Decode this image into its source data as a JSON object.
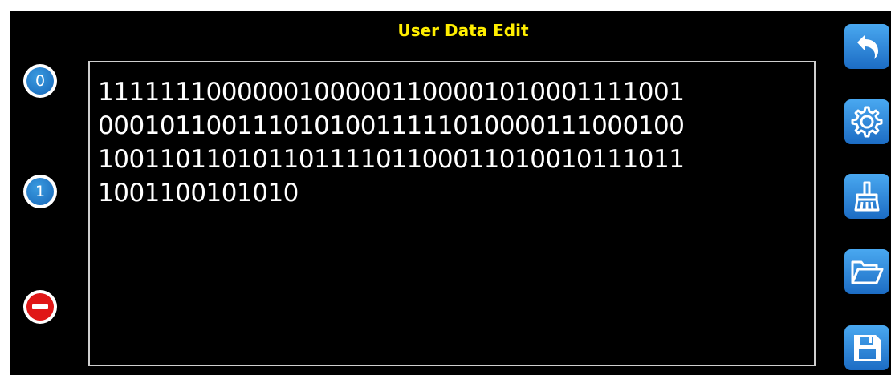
{
  "title": "User Data Edit",
  "keypad": {
    "zero_label": "0",
    "one_label": "1"
  },
  "editor": {
    "lines": [
      "11111110000001000001100001010001111001",
      "00010110011101010011111010000111000100",
      "10011011010110111101100011010010111011",
      "1001100101010"
    ]
  },
  "toolbar": {
    "icons": [
      "back-icon",
      "gear-icon",
      "broom-icon",
      "folder-open-icon",
      "floppy-disk-icon"
    ]
  },
  "colors": {
    "title": "#ffee00",
    "key_blue": "#1f78d1",
    "key_red": "#e01717",
    "tool_gradient_top": "#49a8f0",
    "tool_gradient_bottom": "#1c6cc4"
  }
}
